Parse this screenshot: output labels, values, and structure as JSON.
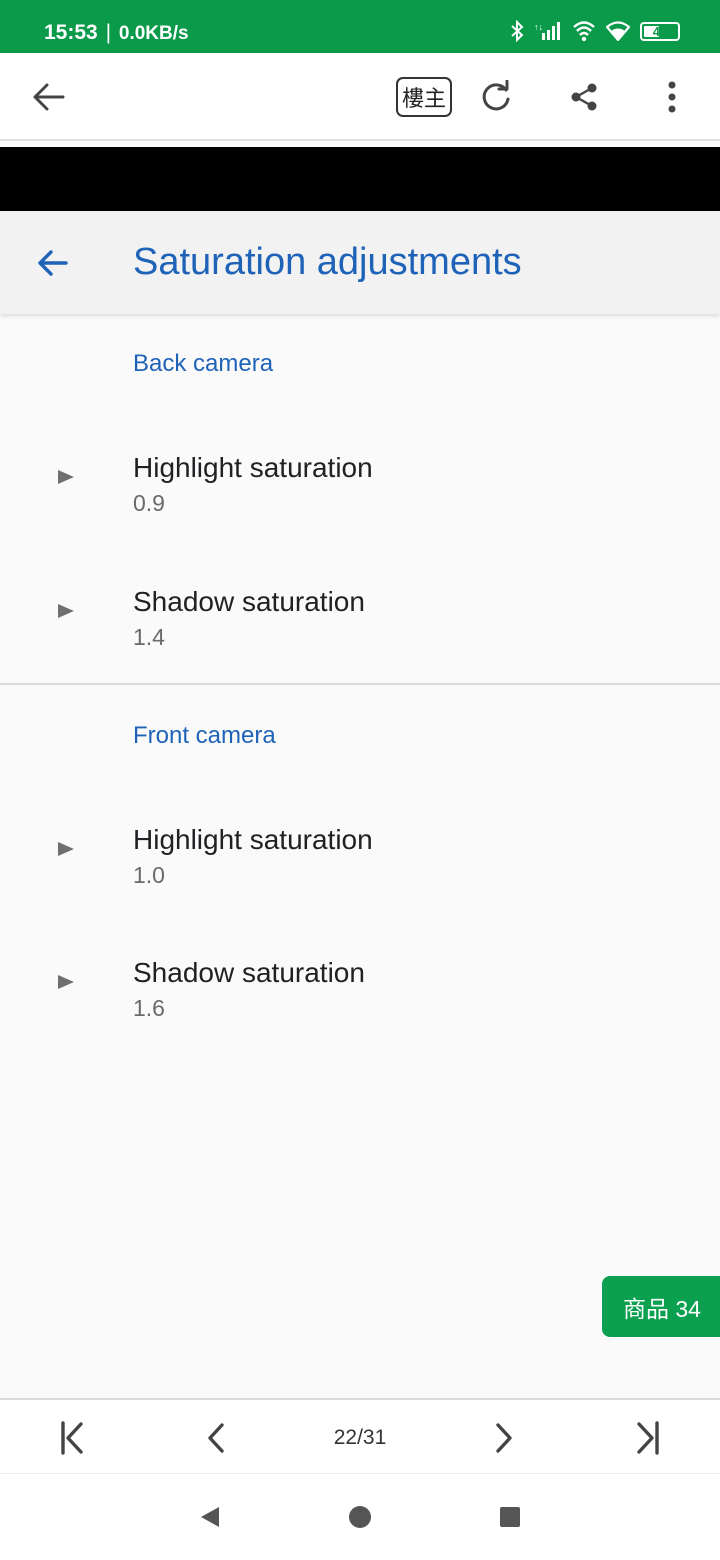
{
  "status_bar": {
    "time": "15:53",
    "separator": "|",
    "net_speed": "0.0KB/s",
    "icons": [
      "bluetooth-icon",
      "signal-icon",
      "hotspot-icon",
      "wifi-icon",
      "battery-icon"
    ],
    "battery_level": "47",
    "battery_fraction": 0.47
  },
  "app_bar": {
    "back_icon": "arrow-left-icon",
    "louzhu_label": "樓主",
    "icons": [
      "refresh-icon",
      "share-icon",
      "more-vert-icon"
    ]
  },
  "settings": {
    "title": "Saturation adjustments",
    "sections": [
      {
        "header": "Back camera",
        "items": [
          {
            "title": "Highlight saturation",
            "value": "0.9"
          },
          {
            "title": "Shadow saturation",
            "value": "1.4"
          }
        ]
      },
      {
        "header": "Front camera",
        "items": [
          {
            "title": "Highlight saturation",
            "value": "1.0"
          },
          {
            "title": "Shadow saturation",
            "value": "1.6"
          }
        ]
      }
    ]
  },
  "goods_button": {
    "label": "商品 34"
  },
  "pager": {
    "label": "22/31"
  },
  "colors": {
    "status_green": "#0a9a4a",
    "accent_blue": "#1f63b8",
    "goods_green": "#0aa04f"
  }
}
